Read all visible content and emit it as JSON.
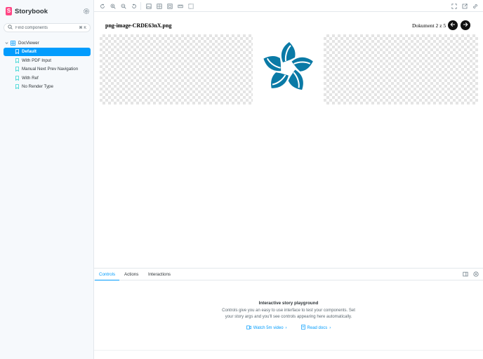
{
  "brand": {
    "name": "Storybook"
  },
  "search": {
    "placeholder": "Find components",
    "shortcut": "⌘ K"
  },
  "tree": {
    "group": "DocViewer",
    "stories": [
      {
        "label": "Default",
        "selected": true
      },
      {
        "label": "With PDF Input"
      },
      {
        "label": "Manual Next Prev Navigation"
      },
      {
        "label": "With Ref"
      },
      {
        "label": "No Render Type"
      }
    ]
  },
  "toolbar": {
    "icons": [
      "reload-icon",
      "zoom-in-icon",
      "zoom-out-icon",
      "zoom-reset-icon",
      "background-icon",
      "grid-icon",
      "viewport-icon",
      "measure-icon",
      "outline-icon",
      "fullscreen-icon",
      "open-new-tab-icon",
      "copy-link-icon"
    ]
  },
  "viewer": {
    "file_name": "png-image-CRDE63nX.png",
    "counter": "Dokument 2 z 5"
  },
  "panel": {
    "tabs": [
      "Controls",
      "Actions",
      "Interactions"
    ],
    "active_tab": "Controls",
    "empty_title": "Interactive story playground",
    "empty_desc_line1": "Controls give you an easy to use interface to test your components. Set",
    "empty_desc_line2": "your story args and you'll see controls appearing here automatically.",
    "video_link": "Watch 5m video",
    "docs_link": "Read docs"
  },
  "colors": {
    "accent": "#029cfd",
    "brand": "#ff4785",
    "logo": "#0a7aa6"
  }
}
